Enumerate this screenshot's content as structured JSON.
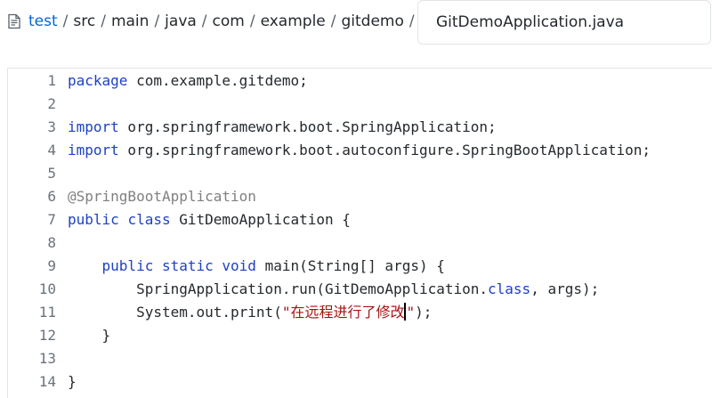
{
  "breadcrumb": {
    "icon": "file-code-icon",
    "items": [
      "test",
      "src",
      "main",
      "java",
      "com",
      "example",
      "gitdemo"
    ],
    "separator": "/"
  },
  "filename": {
    "value": "GitDemoApplication.java"
  },
  "editor": {
    "lines": [
      {
        "number": "1",
        "tokens": [
          {
            "t": "package",
            "c": "kw"
          },
          {
            "t": " com.example.gitdemo;",
            "c": ""
          }
        ]
      },
      {
        "number": "2",
        "tokens": []
      },
      {
        "number": "3",
        "tokens": [
          {
            "t": "import",
            "c": "kw"
          },
          {
            "t": " org.springframework.boot.SpringApplication;",
            "c": ""
          }
        ]
      },
      {
        "number": "4",
        "tokens": [
          {
            "t": "import",
            "c": "kw"
          },
          {
            "t": " org.springframework.boot.autoconfigure.SpringBootApplication;",
            "c": ""
          }
        ]
      },
      {
        "number": "5",
        "tokens": []
      },
      {
        "number": "6",
        "tokens": [
          {
            "t": "@SpringBootApplication",
            "c": "ann"
          }
        ]
      },
      {
        "number": "7",
        "tokens": [
          {
            "t": "public",
            "c": "kw"
          },
          {
            "t": " ",
            "c": ""
          },
          {
            "t": "class",
            "c": "kw"
          },
          {
            "t": " GitDemoApplication {",
            "c": ""
          }
        ]
      },
      {
        "number": "8",
        "tokens": []
      },
      {
        "number": "9",
        "tokens": [
          {
            "t": "    ",
            "c": ""
          },
          {
            "t": "public",
            "c": "kw"
          },
          {
            "t": " ",
            "c": ""
          },
          {
            "t": "static",
            "c": "kw"
          },
          {
            "t": " ",
            "c": ""
          },
          {
            "t": "void",
            "c": "kw"
          },
          {
            "t": " main(String[] args) {",
            "c": ""
          }
        ]
      },
      {
        "number": "10",
        "tokens": [
          {
            "t": "        SpringApplication.run(GitDemoApplication.",
            "c": ""
          },
          {
            "t": "class",
            "c": "kw"
          },
          {
            "t": ", args);",
            "c": ""
          }
        ]
      },
      {
        "number": "11",
        "tokens": [
          {
            "t": "        System.out.print(",
            "c": ""
          },
          {
            "t": "\"在远程进行了修改",
            "c": "str"
          },
          {
            "t": "|CURSOR|",
            "c": "cursor"
          },
          {
            "t": "\"",
            "c": "str"
          },
          {
            "t": ");",
            "c": ""
          }
        ]
      },
      {
        "number": "12",
        "tokens": [
          {
            "t": "    }",
            "c": ""
          }
        ]
      },
      {
        "number": "13",
        "tokens": []
      },
      {
        "number": "14",
        "tokens": [
          {
            "t": "}",
            "c": ""
          }
        ]
      }
    ]
  },
  "colors": {
    "link": "#0366d6",
    "keyword": "#1e40c8",
    "annotation": "#808080",
    "string": "#a31515",
    "line_number": "#6a737d"
  }
}
